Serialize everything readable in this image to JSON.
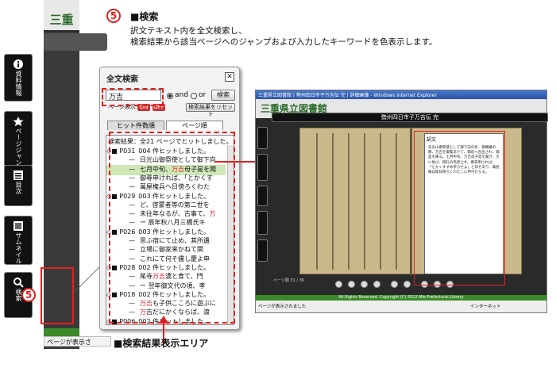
{
  "callout": {
    "number": "5",
    "heading": "■検索",
    "desc_line1": "訳文テキスト内を全文検索し、",
    "desc_line2": "検索結果から該当ページへのジャンプおよび入力したキーワードを色表示します。",
    "results_area_label": "■検索結果表示エリア"
  },
  "left_app": {
    "brand": "三重",
    "status_text": "ページが表示さ",
    "buttons": [
      {
        "label": "資料情報",
        "icon": "info-icon"
      },
      {
        "label": "ページジャンプ",
        "icon": "star-icon"
      },
      {
        "label": "目次",
        "icon": "list-icon"
      },
      {
        "label": "サムネイル",
        "icon": "thumbnail-icon"
      },
      {
        "label": "検索",
        "icon": "search-icon"
      }
    ]
  },
  "search_panel": {
    "title": "全文検索",
    "close": "✕",
    "query": "万吉",
    "and_label": "and",
    "or_label": "or",
    "search_button": "検索",
    "sub_label": "ページ表示",
    "on_label": "ON",
    "off_label": "OFF",
    "reset_button": "検索結果をリセット",
    "tab_hits": "ヒット件数順",
    "tab_pages": "ページ順",
    "result_header": "検索結果：全21 ページでヒットしました。",
    "rows": [
      {
        "page": "P031",
        "text": "004 件ヒットしました。",
        "pre": "",
        "hit": "",
        "post": ""
      },
      {
        "page": "",
        "text": "",
        "pre": "日光山御祭使として御下向",
        "hit": "",
        "post": ""
      },
      {
        "page": "",
        "text": "",
        "pre": "七月中旬、",
        "hit": "万吉",
        "post": "母子是を聞"
      },
      {
        "page": "",
        "text": "",
        "pre": "御尋申ければ、「とかくす",
        "hit": "",
        "post": ""
      },
      {
        "page": "",
        "text": "",
        "pre": "萬屋権兵ヘ日傍ろくわた",
        "hit": "",
        "post": ""
      },
      {
        "page": "P029",
        "text": "003 件ヒットしました。",
        "pre": "",
        "hit": "",
        "post": ""
      },
      {
        "page": "",
        "text": "",
        "pre": "ど、啓蒙者等の第二世を",
        "hit": "",
        "post": ""
      },
      {
        "page": "",
        "text": "",
        "pre": "未往年なるが、古事て、",
        "hit": "万",
        "post": ""
      },
      {
        "page": "",
        "text": "",
        "pre": "ー 辰年秋八月三橋氏キ",
        "hit": "",
        "post": ""
      },
      {
        "page": "P026",
        "text": "003 件ヒットしました。",
        "pre": "",
        "hit": "",
        "post": ""
      },
      {
        "page": "",
        "text": "",
        "pre": "思ふ宿にて止め、其所遺",
        "hit": "",
        "post": ""
      },
      {
        "page": "",
        "text": "",
        "pre": "立場に御家来かねて関",
        "hit": "",
        "post": ""
      },
      {
        "page": "",
        "text": "",
        "pre": "これにて何そ儘し慶よ申",
        "hit": "",
        "post": ""
      },
      {
        "page": "P028",
        "text": "002 件ヒットしました。",
        "pre": "",
        "hit": "",
        "post": ""
      },
      {
        "page": "",
        "text": "",
        "pre": "尾寺",
        "hit": "万吉",
        "post": "濃と食て、門"
      },
      {
        "page": "",
        "text": "",
        "pre": "ー 翌年御文代の頃、孝",
        "hit": "",
        "post": ""
      },
      {
        "page": "P018",
        "text": "002 件ヒットしました。",
        "pre": "",
        "hit": "",
        "post": ""
      },
      {
        "page": "",
        "text": "",
        "pre": "",
        "hit": "万吉",
        "post": "も子供こころに遊ぶに"
      },
      {
        "page": "",
        "text": "",
        "pre": "",
        "hit": "万",
        "post": "吉だにかくならば、渡"
      },
      {
        "page": "P006",
        "text": "002 件ヒットしました。",
        "pre": "",
        "hit": "",
        "post": ""
      }
    ]
  },
  "screenshot": {
    "window_title": "三重県立図書館 | 勢州四日市子万吉伝 完 | 詳細画像 - Windows Internet Explorer",
    "brand": "三重県立図書館",
    "book_title": "勢州四日市子万吉伝 完",
    "popup_title": "訳文",
    "popup_text": "日光山御祭使として御下向の折、御機嫌の節、万吉を御覧ありて、御前へ召出され、御盃を賜る。七月中旬、万吉母子是を聞き、大に悦び、御礼の為参上す。御尋申ければ、「とかくすすめ参らせよ」と仰せあり、萬屋権兵衛日傍ろくわたしに申付けらる。",
    "page_counter": "ページ順 31 / 36",
    "footer": "All Rights Reserved. Copyright (C) 2012 Mie Prefectural Library",
    "status_left": "ページが表示されました",
    "status_right": "インターネット"
  },
  "colors": {
    "accent_red": "#e02020",
    "brand_green": "#2a6a2a",
    "footer_green": "#3a8a2a"
  }
}
